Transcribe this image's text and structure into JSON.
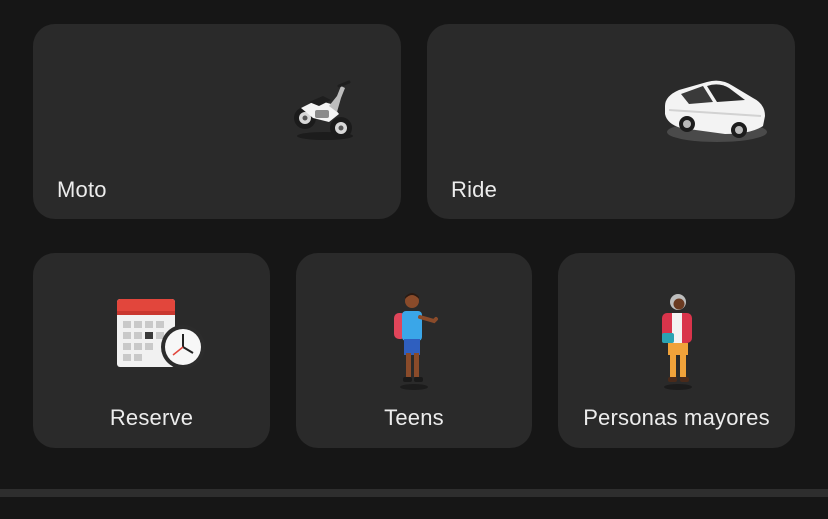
{
  "services": {
    "moto": {
      "label": "Moto",
      "icon": "motorcycle-icon"
    },
    "ride": {
      "label": "Ride",
      "icon": "car-icon"
    },
    "reserve": {
      "label": "Reserve",
      "icon": "calendar-clock-icon"
    },
    "teens": {
      "label": "Teens",
      "icon": "teen-person-icon"
    },
    "seniors": {
      "label": "Personas mayores",
      "icon": "senior-person-icon"
    }
  },
  "colors": {
    "background": "#161616",
    "card": "#2a2a2a",
    "text": "#ececec",
    "accent_red": "#e2463c"
  }
}
